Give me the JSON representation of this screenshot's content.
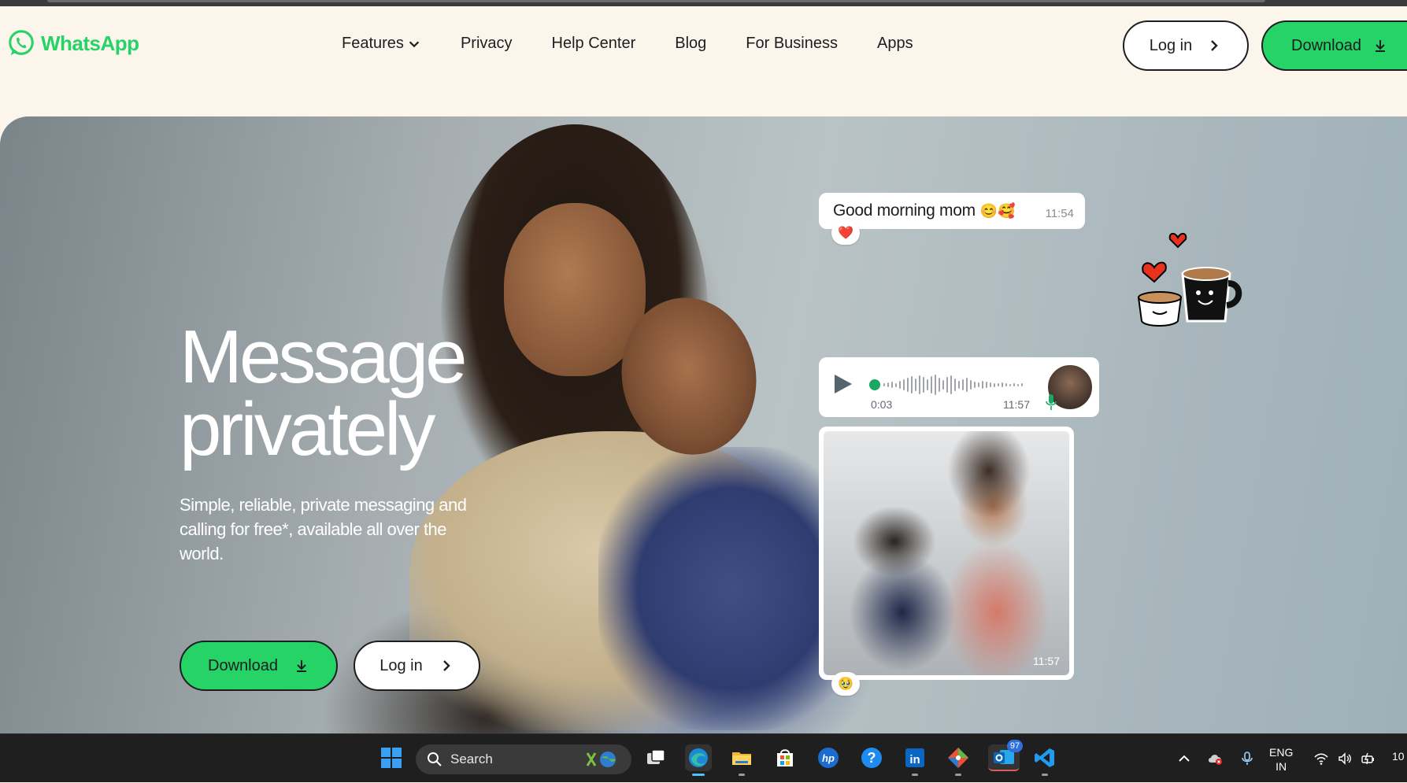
{
  "header": {
    "brand": "WhatsApp",
    "nav": [
      {
        "label": "Features",
        "has_dropdown": true
      },
      {
        "label": "Privacy"
      },
      {
        "label": "Help Center"
      },
      {
        "label": "Blog"
      },
      {
        "label": "For Business"
      },
      {
        "label": "Apps"
      }
    ],
    "login_label": "Log in",
    "download_label": "Download"
  },
  "hero": {
    "title_line1": "Message",
    "title_line2": "privately",
    "subtitle": "Simple, reliable, private messaging and calling for free*, available all over the world.",
    "download_label": "Download",
    "login_label": "Log in"
  },
  "chat": {
    "message_text": "Good morning mom",
    "message_emoji": "😊🥰",
    "message_time": "11:54",
    "message_reaction": "❤️",
    "voice_elapsed": "0:03",
    "voice_time": "11:57",
    "photo_time": "11:57",
    "photo_reaction": "🥹"
  },
  "taskbar": {
    "search_placeholder": "Search",
    "outlook_badge": "97",
    "lang_line1": "ENG",
    "lang_line2": "IN",
    "clock": "10"
  },
  "colors": {
    "brand_green": "#25d366",
    "page_bg": "#fcf5eb",
    "text_dark": "#1c1e21"
  }
}
